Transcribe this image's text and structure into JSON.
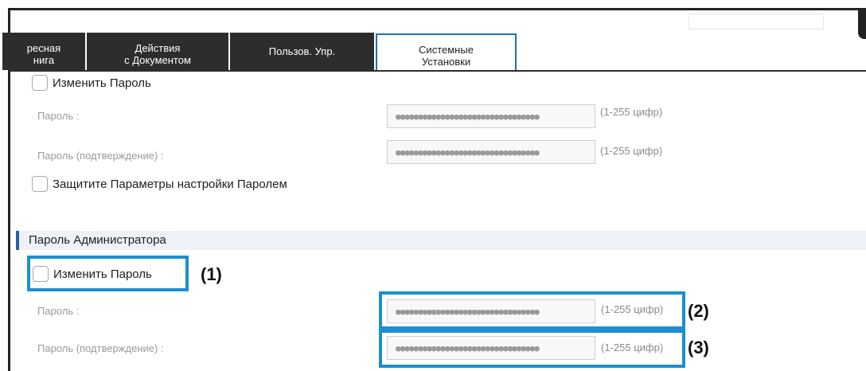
{
  "tabs": [
    {
      "label": "ресная\nнига"
    },
    {
      "label": "Действия\nс Документом"
    },
    {
      "label": "Пользов. Упр."
    },
    {
      "label": "Системные\nУстановки"
    }
  ],
  "top_section": {
    "change_password_label": "Изменить Пароль",
    "password_label": "Пароль :",
    "password_value": "●●●●●●●●●●●●●●●●●●●●●●●●●●●●●●●●",
    "password_hint": "(1-255 цифр)",
    "confirm_label": "Пароль (подтверждение) :",
    "confirm_value": "●●●●●●●●●●●●●●●●●●●●●●●●●●●●●●●●",
    "confirm_hint": "(1-255 цифр)",
    "protect_label": "Защитите Параметры настройки Паролем"
  },
  "admin_section": {
    "title": "Пароль Администратора",
    "change_password_label": "Изменить Пароль",
    "password_label": "Пароль :",
    "password_value": "●●●●●●●●●●●●●●●●●●●●●●●●●●●●●●●●",
    "password_hint": "(1-255 цифр)",
    "confirm_label": "Пароль (подтверждение) :",
    "confirm_value": "●●●●●●●●●●●●●●●●●●●●●●●●●●●●●●●●",
    "confirm_hint": "(1-255 цифр)"
  },
  "annotations": [
    "(1)",
    "(2)",
    "(3)"
  ],
  "colors": {
    "highlight": "#1b8fd1",
    "tab_bg": "#2d2d2d",
    "active_tab_border": "#1f6fbf"
  }
}
